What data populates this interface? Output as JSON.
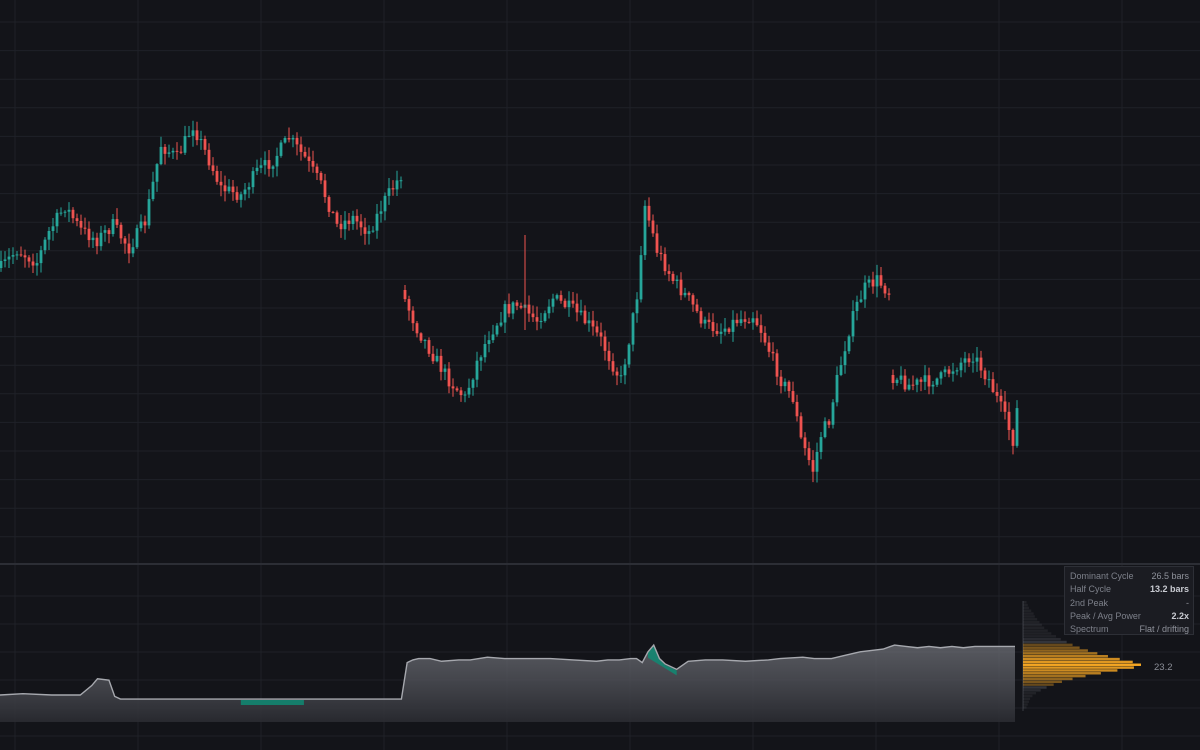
{
  "info": [
    {
      "label": "Dominant Cycle",
      "value": "26.5 bars",
      "bold": false
    },
    {
      "label": "Half Cycle",
      "value": "13.2 bars",
      "bold": true
    },
    {
      "label": "2nd Peak",
      "value": "-",
      "bold": false
    },
    {
      "label": "Peak / Avg Power",
      "value": "2.2x",
      "bold": true
    },
    {
      "label": "Spectrum",
      "value": "Flat / drifting",
      "bold": false
    }
  ],
  "peak_label": "23.2",
  "colors": {
    "background": "#131419",
    "grid": "#1f2128",
    "up": "#26a69a",
    "down": "#ef5350",
    "line": "#a6a8ae",
    "highlight": "#0f8a73",
    "histogram": "#f5a623"
  },
  "chart_data": [
    {
      "type": "candlestick",
      "title": "",
      "bar_count": 178,
      "gaps": [
        {
          "after_bar": 69,
          "kind": "drop"
        },
        {
          "after_bar": 153,
          "kind": "blank"
        }
      ],
      "grid": true,
      "axes": "hidden"
    },
    {
      "type": "area",
      "title": "",
      "x": [
        0,
        4,
        9,
        14,
        16,
        17,
        19,
        20,
        21,
        24,
        35,
        42,
        43,
        45,
        50,
        53,
        57,
        60,
        62,
        65,
        70,
        71,
        72,
        73,
        75,
        77,
        80,
        82,
        85,
        88,
        92,
        96,
        100,
        104,
        106,
        108,
        110,
        111,
        112,
        113,
        114,
        115,
        116,
        118,
        120,
        123,
        126,
        130,
        134,
        136,
        140,
        142,
        145,
        147,
        150,
        152,
        154,
        156,
        158,
        160,
        162,
        164,
        166,
        168,
        170,
        172,
        175,
        177
      ],
      "values": [
        20,
        21,
        20,
        20,
        27,
        32,
        31,
        19,
        17,
        17,
        17,
        17,
        17,
        17,
        17,
        17,
        17,
        17,
        17,
        17,
        17,
        44,
        46,
        47,
        47,
        45,
        46,
        46,
        48,
        47,
        47,
        47,
        46,
        45,
        46,
        46,
        47,
        47,
        44,
        52,
        57,
        47,
        43,
        39,
        45,
        46,
        46,
        45,
        46,
        47,
        48,
        47,
        47,
        49,
        52,
        53,
        54,
        57,
        56,
        55,
        56,
        55,
        56,
        55,
        56,
        56,
        56,
        56
      ],
      "highlights": [
        {
          "from": 42,
          "to": 56
        },
        {
          "from": 113,
          "to": 119
        }
      ],
      "grid": true
    },
    {
      "type": "bar",
      "title": "",
      "orientation": "horizontal",
      "values": [
        3,
        4,
        5,
        7,
        9,
        10,
        12,
        14,
        16,
        18,
        21,
        24,
        28,
        32,
        37,
        42,
        48,
        55,
        63,
        72,
        82,
        93,
        100,
        94,
        80,
        66,
        53,
        42,
        33,
        26,
        20,
        15,
        11,
        8,
        6,
        5,
        4,
        3
      ],
      "peak_index": 22
    }
  ]
}
